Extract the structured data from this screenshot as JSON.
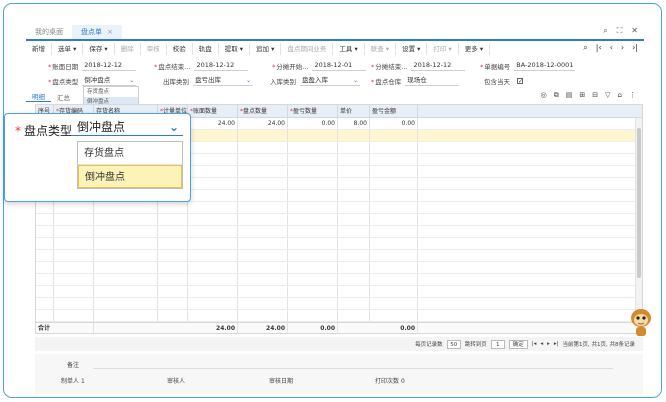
{
  "tabs": [
    {
      "label": "我的桌面"
    },
    {
      "label": "盘点单"
    }
  ],
  "toolbar": {
    "buttons": [
      {
        "label": "新增"
      },
      {
        "label": "选单 ▾"
      },
      {
        "label": "保存 ▾"
      },
      {
        "label": "删除"
      },
      {
        "label": "审核"
      },
      {
        "label": "校验"
      },
      {
        "label": "轨盘"
      },
      {
        "label": "提取 ▾"
      },
      {
        "label": "追加 ▾"
      },
      {
        "label": "盘点期间业务"
      },
      {
        "label": "工具 ▾"
      },
      {
        "label": "联查 ▾"
      },
      {
        "label": "设置 ▾"
      },
      {
        "label": "打印 ▾"
      },
      {
        "label": "更多 ▾"
      }
    ]
  },
  "form": {
    "row1": [
      {
        "label": "账面日期",
        "value": "2018-12-12",
        "required": true
      },
      {
        "label": "盘点结束...",
        "value": "2018-12-12",
        "required": true
      },
      {
        "label": "分摊开始...",
        "value": "2018-12-01",
        "required": true
      },
      {
        "label": "分摊结束...",
        "value": "2018-12-12",
        "required": true
      },
      {
        "label": "单据编号",
        "value": "BA-2018-12-0001",
        "required": true
      }
    ],
    "row2": [
      {
        "label": "盘点类型",
        "value": "倒冲盘点",
        "required": true
      },
      {
        "label": "出库类别",
        "value": "盘亏出库",
        "required": false
      },
      {
        "label": "入库类别",
        "value": "盘盈入库",
        "required": false
      },
      {
        "label": "盘点仓库",
        "value": "现场仓",
        "required": true
      },
      {
        "label": "包含当天",
        "value": "✓",
        "required": false
      }
    ]
  },
  "type_dropdown": {
    "options": [
      "存货盘点",
      "倒冲盘点"
    ],
    "selected": "倒冲盘点"
  },
  "subtabs": [
    {
      "label": "明细"
    },
    {
      "label": "汇总"
    }
  ],
  "grid": {
    "columns": [
      "序号",
      "存货编码",
      "存货名称",
      "计量单位",
      "账面数量",
      "盘点数量",
      "盈亏数量",
      "单价",
      "盈亏金额"
    ],
    "rows": [
      [
        "",
        "",
        "",
        "",
        "24.00",
        "24.00",
        "0.00",
        "8.00",
        "0.00"
      ]
    ],
    "total": {
      "label": "合计",
      "book": "24.00",
      "count": "24.00",
      "diff": "0.00",
      "amount": "0.00"
    }
  },
  "pager": {
    "per_page_label": "每页记录数",
    "per_page": "50",
    "goto_label": "跳转到页",
    "goto_page": "1",
    "confirm": "确定",
    "summary": "当前第1页, 共1页, 共8条记录"
  },
  "footer": {
    "remark": "备注",
    "maker_label": "制单人",
    "maker": "1",
    "auditor_label": "审核人",
    "audit_date_label": "审核日期",
    "print_label": "打印次数",
    "print_count": "0"
  },
  "callout": {
    "label": "盘点类型",
    "value": "倒冲盘点",
    "options": [
      "存货盘点",
      "倒冲盘点"
    ]
  },
  "colors": {
    "accent": "#2e78d6",
    "highlight": "#fdf3b8",
    "required": "#e23c3c"
  }
}
